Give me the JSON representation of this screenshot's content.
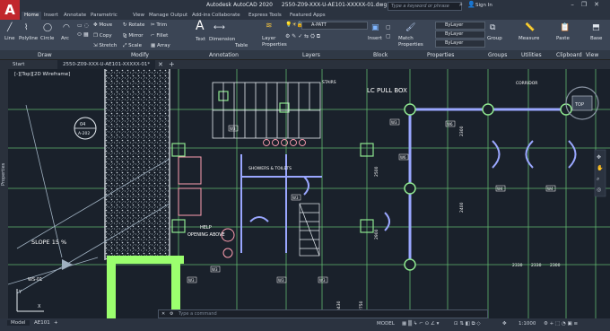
{
  "app": {
    "logo_letter": "A",
    "product": "Autodesk AutoCAD 2020",
    "file": "2550-Z09-XXX-U-AE101-XXXXX-01.dwg",
    "search_placeholder": "Type a keyword or phrase",
    "sign_in": "Sign In"
  },
  "ribbon_tabs": [
    "Home",
    "Insert",
    "Annotate",
    "Parametric",
    "View",
    "Manage",
    "Output",
    "Add-ins",
    "Collaborate",
    "Express Tools",
    "Featured Apps"
  ],
  "ribbon": {
    "draw": [
      "Line",
      "Polyline",
      "Circle",
      "Arc"
    ],
    "modify": [
      "Move",
      "Rotate",
      "Trim",
      "Copy",
      "Mirror",
      "Fillet",
      "Stretch",
      "Scale",
      "Array"
    ],
    "annotation": [
      "Text",
      "Dimension",
      "Table"
    ],
    "layers": {
      "layer_properties": "Layer Properties",
      "current_layer": "A-PATT"
    },
    "block": "Insert",
    "properties": {
      "match": "Match Properties",
      "bylayer1": "ByLayer",
      "bylayer2": "ByLayer",
      "bylayer3": "ByLayer"
    },
    "groups": "Group",
    "utilities": "Measure",
    "clipboard": "Paste",
    "view": "Base"
  },
  "panel_titles": [
    "Draw",
    "Modify",
    "Annotation",
    "Layers",
    "Block",
    "Properties",
    "Groups",
    "Utilities",
    "Clipboard",
    "View"
  ],
  "file_tabs": {
    "start": "Start",
    "current": "2550-Z09-XXX-U-AE101-XXXXX-01*"
  },
  "sidebar": {
    "label": "Properties"
  },
  "viewport": {
    "label": "[-][Top][2D Wireframe]"
  },
  "drawing_labels": {
    "stairs": "STAIRS",
    "lc_pull_box": "LC PULL BOX",
    "showers": "SHOWERS & TOILETS",
    "corridor": "CORRIDOR",
    "slope": "SLOPE 15 %",
    "help_opening": "HELP",
    "opening_above": "OPENING ABOVE",
    "a202": "A-202",
    "ws": "WS-01",
    "dims": [
      "2500",
      "2900",
      "2750",
      "3430",
      "2300",
      "2400",
      "2330",
      "2300",
      "2330"
    ],
    "w_tags": [
      "W3",
      "W3",
      "W6",
      "W6",
      "W3",
      "W3",
      "W3",
      "W4",
      "W4",
      "W3",
      "W3"
    ]
  },
  "command": {
    "placeholder": "Type a command"
  },
  "status": {
    "tabs": [
      "Model",
      "AE101"
    ],
    "mode": "MODEL",
    "scale": "1:1000"
  },
  "colors": {
    "accent": "#c1272d",
    "grid_green": "#7fe08a",
    "wall_white": "#e8eef3",
    "dim_blue": "#9aa7ff",
    "pink": "#ff9fb0"
  }
}
